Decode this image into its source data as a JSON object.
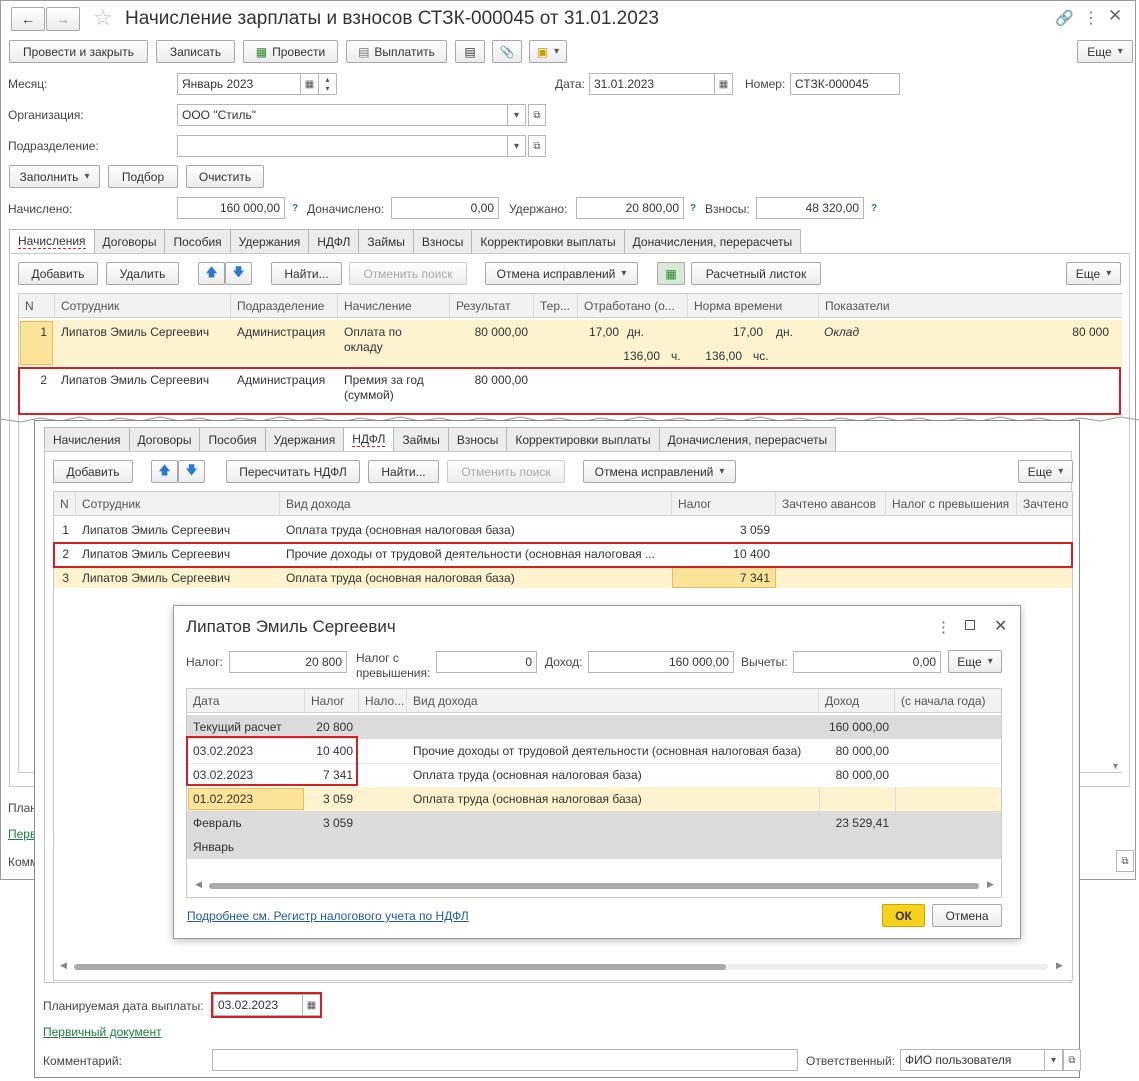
{
  "window": {
    "title": "Начисление зарплаты и взносов СТЗК-000045 от 31.01.2023"
  },
  "toolbar": {
    "post_close": "Провести и закрыть",
    "save": "Записать",
    "post": "Провести",
    "pay": "Выплатить",
    "more": "Еще"
  },
  "fields": {
    "month_label": "Месяц:",
    "month": "Январь 2023",
    "date_label": "Дата:",
    "date": "31.01.2023",
    "number_label": "Номер:",
    "number": "СТЗК-000045",
    "org_label": "Организация:",
    "org": "ООО \"Стиль\"",
    "dept_label": "Подразделение:",
    "dept": ""
  },
  "fill": {
    "fill": "Заполнить",
    "pick": "Подбор",
    "clear": "Очистить"
  },
  "totals": {
    "accrued_label": "Начислено:",
    "accrued": "160 000,00",
    "extra_label": "Доначислено:",
    "extra": "0,00",
    "withheld_label": "Удержано:",
    "withheld": "20 800,00",
    "contrib_label": "Взносы:",
    "contrib": "48 320,00",
    "q": "?"
  },
  "tabs": [
    "Начисления",
    "Договоры",
    "Пособия",
    "Удержания",
    "НДФЛ",
    "Займы",
    "Взносы",
    "Корректировки выплаты",
    "Доначисления, перерасчеты"
  ],
  "acc_toolbar": {
    "add": "Добавить",
    "delete": "Удалить",
    "find": "Найти...",
    "cancel_find": "Отменить поиск",
    "corrections": "Отмена исправлений",
    "payslip": "Расчетный листок",
    "more": "Еще"
  },
  "acc_table": {
    "headers": [
      "N",
      "Сотрудник",
      "Подразделение",
      "Начисление",
      "Результат",
      "Тер...",
      "Отработано (о...",
      "Норма времени",
      "Показатели"
    ],
    "rows": [
      {
        "n": "1",
        "emp": "Липатов Эмиль Сергеевич",
        "dept": "Администрация",
        "acc1": "Оплата по",
        "acc2": "окладу",
        "res": "80 000,00",
        "days": "17,00",
        "dn": "дн.",
        "hrs": "136,00",
        "ch": "ч.",
        "ndays": "17,00",
        "ndn": "дн.",
        "nhrs": "136,00",
        "nch": "чс.",
        "ind": "Оклад",
        "indv": "80 000"
      },
      {
        "n": "2",
        "emp": "Липатов Эмиль Сергеевич",
        "dept": "Администрация",
        "acc1": "Премия за год",
        "acc2": "(суммой)",
        "res": "80 000,00"
      }
    ]
  },
  "bg_bottom": {
    "plan": "Плани",
    "doc": "Перви",
    "comment": "Коммен"
  },
  "ndfl_toolbar": {
    "add": "Добавить",
    "recalc": "Пересчитать НДФЛ",
    "find": "Найти...",
    "cancel_find": "Отменить поиск",
    "corrections": "Отмена исправлений",
    "more": "Еще"
  },
  "ndfl_table": {
    "headers": [
      "N",
      "Сотрудник",
      "Вид дохода",
      "Налог",
      "Зачтено авансов",
      "Налог с превышения",
      "Зачтено"
    ],
    "rows": [
      {
        "n": "1",
        "emp": "Липатов Эмиль Сергеевич",
        "kind": "Оплата труда (основная налоговая база)",
        "tax": "3 059"
      },
      {
        "n": "2",
        "emp": "Липатов Эмиль Сергеевич",
        "kind": "Прочие доходы от трудовой деятельности (основная налоговая ...",
        "tax": "10 400"
      },
      {
        "n": "3",
        "emp": "Липатов Эмиль Сергеевич",
        "kind": "Оплата труда (основная налоговая база)",
        "tax": "7 341"
      }
    ]
  },
  "dialog": {
    "title": "Липатов Эмиль Сергеевич",
    "tax_label": "Налог:",
    "tax": "20 800",
    "over_label1": "Налог с",
    "over_label2": "превышения:",
    "over": "0",
    "income_label": "Доход:",
    "income": "160 000,00",
    "deduct_label": "Вычеты:",
    "deduct": "0,00",
    "more": "Еще",
    "headers": [
      "Дата",
      "Налог",
      "Нало...",
      "Вид дохода",
      "Доход",
      "(с начала года)"
    ],
    "rows": [
      {
        "date": "Текущий расчет",
        "tax": "20 800",
        "kind": "",
        "income": "160 000,00"
      },
      {
        "date": "03.02.2023",
        "tax": "10 400",
        "kind": "Прочие доходы от трудовой деятельности (основная налоговая база)",
        "income": "80 000,00"
      },
      {
        "date": "03.02.2023",
        "tax": "7 341",
        "kind": "Оплата труда (основная налоговая база)",
        "income": "80 000,00"
      },
      {
        "date": "01.02.2023",
        "tax": "3 059",
        "kind": "Оплата труда (основная налоговая база)",
        "income": ""
      },
      {
        "date": "Февраль",
        "tax": "3 059",
        "kind": "",
        "income": "23 529,41"
      },
      {
        "date": "Январь",
        "tax": "",
        "kind": "",
        "income": ""
      }
    ],
    "link": "Подробнее см. Регистр налогового учета по НДФЛ",
    "ok": "ОК",
    "cancel": "Отмена"
  },
  "fg_bottom": {
    "plan_label": "Планируемая дата выплаты:",
    "plan_date": "03.02.2023",
    "doc_link": "Первичный документ",
    "comment_label": "Комментарий:",
    "resp_label": "Ответственный:",
    "resp": "ФИО пользователя"
  },
  "colors": {
    "highlight": "#fdf3cf",
    "selected": "#fbe49a",
    "red": "#d62020",
    "ok": "#f6d21e"
  }
}
